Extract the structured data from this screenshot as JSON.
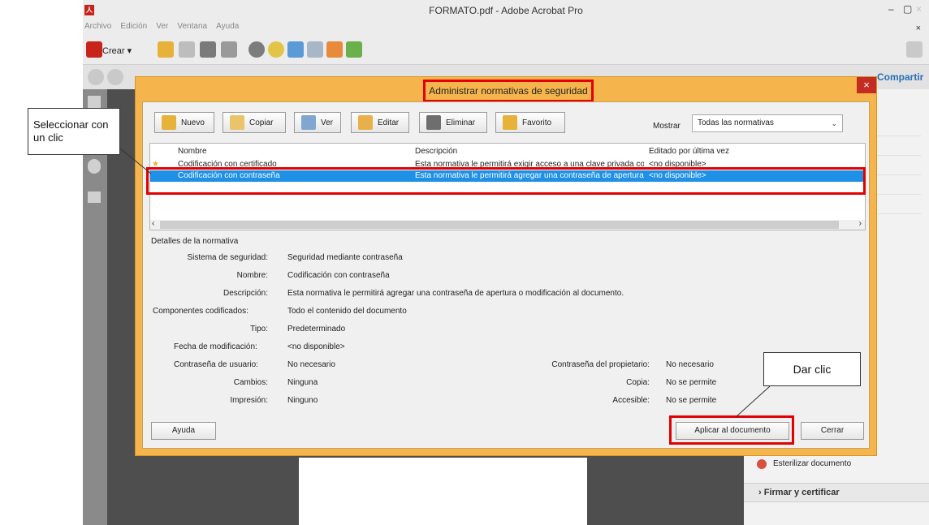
{
  "window": {
    "title": "FORMATO.pdf - Adobe Acrobat Pro",
    "app_icon": "pdf-icon",
    "minimize": "–",
    "maximize": "▢",
    "close": "×"
  },
  "menu": [
    "Archivo",
    "Edición",
    "Ver",
    "Ventana",
    "Ayuda"
  ],
  "menu_close": "×",
  "toolbar": {
    "crear_label": "Crear",
    "crear_chevron": "▾",
    "compartir_label": "Compartir"
  },
  "right_panel": {
    "esterilizar": "Esterilizar documento",
    "firmar": "› Firmar y certificar"
  },
  "dialog": {
    "title": "Administrar normativas de seguridad",
    "close": "×",
    "buttons": {
      "nuevo": "Nuevo",
      "copiar": "Copiar",
      "ver": "Ver",
      "editar": "Editar",
      "eliminar": "Eliminar",
      "favorito": "Favorito"
    },
    "mostrar_label": "Mostrar",
    "mostrar_value": "Todas las normativas",
    "columns": [
      "Nombre",
      "Descripción",
      "Editado por última vez"
    ],
    "rows": [
      {
        "nombre": "Codificación con certificado",
        "descripcion": "Esta normativa le permitirá exigir acceso a una clave privada concre...",
        "editado": "<no disponible>",
        "selected": false
      },
      {
        "nombre": "Codificación con contraseña",
        "descripcion": "Esta normativa le permitirá agregar una contraseña de apertura o ...",
        "editado": "<no disponible>",
        "selected": true
      }
    ],
    "details": {
      "header": "Detalles de la normativa",
      "sistema_label": "Sistema de seguridad:",
      "sistema_value": "Seguridad mediante contraseña",
      "nombre_label": "Nombre:",
      "nombre_value": "Codificación con contraseña",
      "descripcion_label": "Descripción:",
      "descripcion_value": "Esta normativa le permitirá agregar una contraseña de apertura o modificación al documento.",
      "componentes_label": "Componentes codificados:",
      "componentes_value": "Todo el contenido del documento",
      "tipo_label": "Tipo:",
      "tipo_value": "Predeterminado",
      "fecha_label": "Fecha de modificación:",
      "fecha_value": "<no disponible>",
      "pw_usuario_label": "Contraseña de usuario:",
      "pw_usuario_value": "No necesario",
      "pw_propietario_label": "Contraseña del propietario:",
      "pw_propietario_value": "No necesario",
      "cambios_label": "Cambios:",
      "cambios_value": "Ninguna",
      "copia_label": "Copia:",
      "copia_value": "No se permite",
      "impresion_label": "Impresión:",
      "impresion_value": "Ninguno",
      "accesible_label": "Accesible:",
      "accesible_value": "No se permite"
    },
    "footer": {
      "ayuda": "Ayuda",
      "aplicar": "Aplicar al documento",
      "cerrar": "Cerrar"
    }
  },
  "annotations": {
    "seleccionar": "Seleccionar con un clic",
    "dar_clic": "Dar clic",
    "highlight_color": "#e20000"
  },
  "colors": {
    "dialog_frame": "#f5b54c",
    "selection": "#1e90e6",
    "close_button": "#c42c21"
  }
}
